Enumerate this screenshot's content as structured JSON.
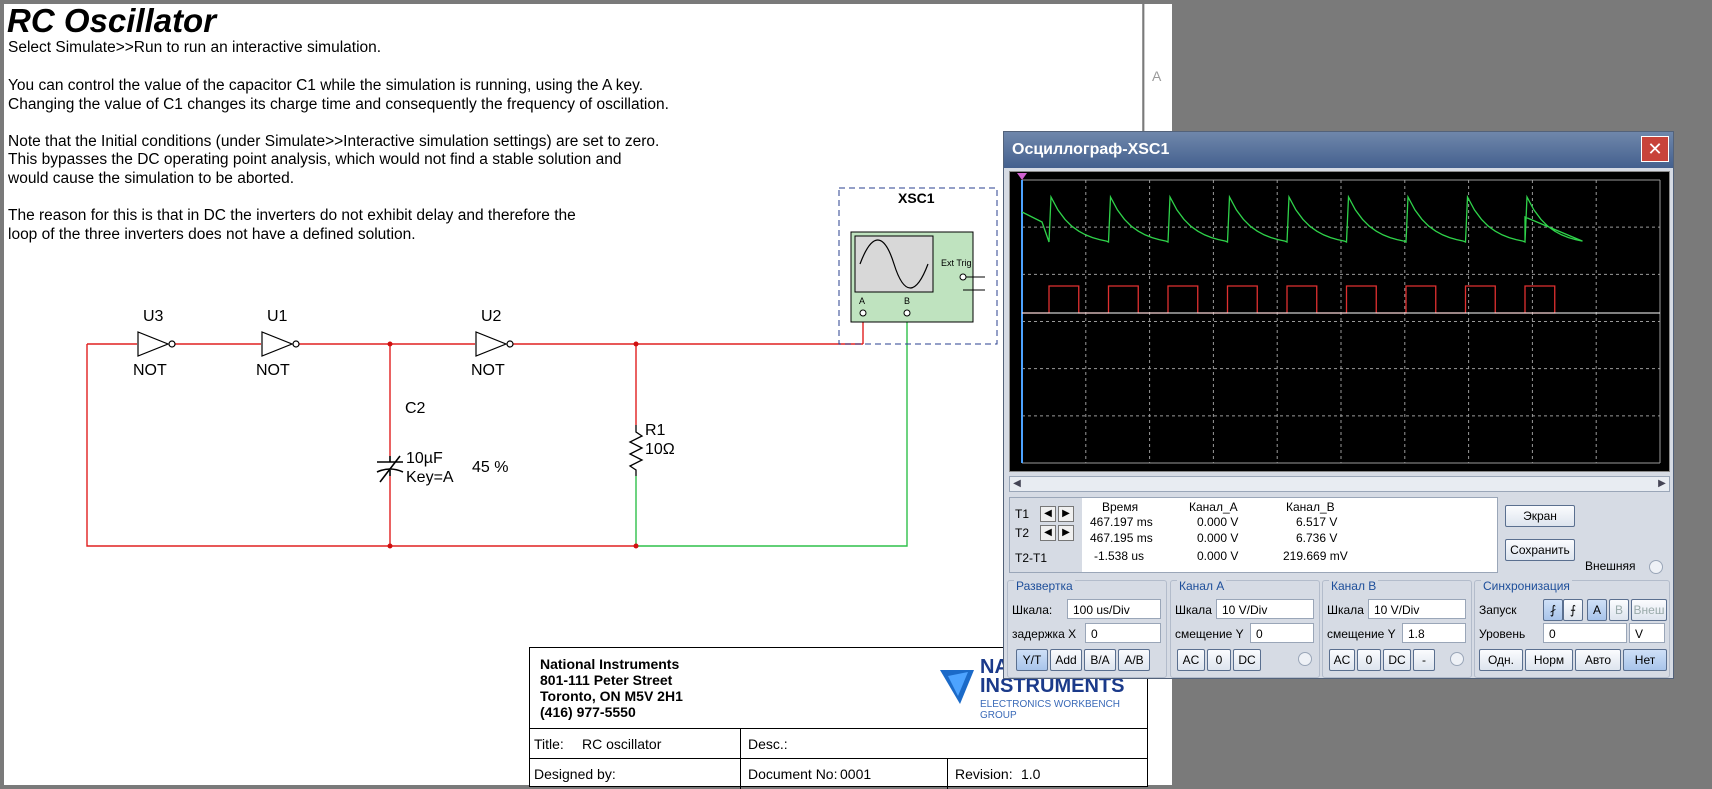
{
  "sheet": {
    "title": "RC Oscillator",
    "paragraphs": [
      "Select Simulate>>Run to run an interactive simulation.",
      "You can control the value of the capacitor C1 while the simulation is running, using the A key.",
      "Changing the value of C1 changes its charge time and consequently the frequency of oscillation.",
      "Note that the Initial conditions (under Simulate>>Interactive simulation settings) are set to zero.",
      "This bypasses the DC operating point analysis, which would not find a stable solution and",
      "would cause the simulation to be aborted.",
      "The reason for this is that in DC the inverters do not exhibit delay and therefore the",
      "loop of the three inverters does not have a defined solution."
    ],
    "margin_letter": "A"
  },
  "circuit": {
    "u3": "U3",
    "u1": "U1",
    "u2": "U2",
    "not": "NOT",
    "c2": "C2",
    "c_value": "10µF",
    "c_key": "Key=A",
    "c_percent": "45 %",
    "r1": "R1",
    "r_value": "10Ω",
    "xsc": "XSC1",
    "ext_trig": "Ext Trig",
    "ch_a": "A",
    "ch_b": "B"
  },
  "title_block": {
    "company": "National Instruments",
    "address1": "801-111 Peter Street",
    "address2": "Toronto, ON M5V 2H1",
    "phone": "(416) 977-5550",
    "logo_line1": "NATIONAL",
    "logo_line2": "INSTRUMENTS",
    "logo_sub": "ELECTRONICS WORKBENCH GROUP",
    "title_label": "Title:",
    "title_value": "RC oscillator",
    "desc_label": "Desc.:",
    "designed_label": "Designed by:",
    "docno_label": "Document No:",
    "docno_value": "0001",
    "rev_label": "Revision:",
    "rev_value": "1.0"
  },
  "oscilloscope": {
    "window_title": "Осциллограф-XSC1",
    "close": "✕",
    "colors": {
      "channel_a": "#2fd34a",
      "channel_b": "#e03030",
      "grid": "#9a9a9a",
      "cursor": "#4da3ff"
    },
    "readout": {
      "t1": "T1",
      "t2": "T2",
      "t2t1": "T2-T1",
      "headers": [
        "Время",
        "Канал_A",
        "Канал_B"
      ],
      "rows": [
        [
          "467.197 ms",
          "0.000 V",
          "6.517 V"
        ],
        [
          "467.195 ms",
          "0.000 V",
          "6.736 V"
        ],
        [
          "-1.538 us",
          "0.000 V",
          "219.669 mV"
        ]
      ]
    },
    "buttons": {
      "screen": "Экран",
      "save": "Сохранить",
      "external": "Внешняя"
    },
    "timebase": {
      "title": "Развертка",
      "scale_label": "Шкала:",
      "scale_value": "100 us/Div",
      "delay_label": "задержка X",
      "delay_value": "0",
      "modes": [
        "Y/T",
        "Add",
        "B/A",
        "A/B"
      ]
    },
    "channel_a": {
      "title": "Канал A",
      "scale_label": "Шкала",
      "scale_value": "10  V/Div",
      "offset_label": "смещение Y",
      "offset_value": "0",
      "coupling": [
        "AC",
        "0",
        "DC"
      ]
    },
    "channel_b": {
      "title": "Канал B",
      "scale_label": "Шкала",
      "scale_value": "10  V/Div",
      "offset_label": "смещение Y",
      "offset_value": "1.8",
      "coupling": [
        "AC",
        "0",
        "DC",
        "-"
      ]
    },
    "trigger": {
      "title": "Синхронизация",
      "edge_label": "Запуск",
      "sources": [
        "A",
        "B",
        "Внеш"
      ],
      "level_label": "Уровень",
      "level_value": "0",
      "level_unit": "V",
      "modes": [
        "Одн.",
        "Норм",
        "Авто",
        "Нет"
      ]
    }
  }
}
